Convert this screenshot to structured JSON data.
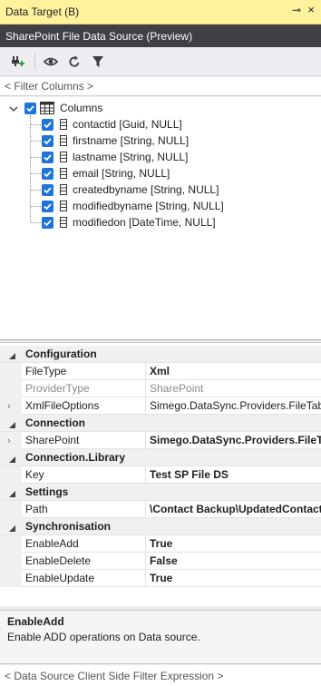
{
  "window": {
    "title": "Data Target (B)",
    "pin_glyph": "⊸",
    "close_glyph": "×"
  },
  "subheader": "SharePoint File Data Source (Preview)",
  "toolbar": {
    "icons": [
      "add-column-icon",
      "eye-icon",
      "refresh-icon",
      "filter-icon"
    ]
  },
  "filter_placeholder": "< Filter Columns >",
  "tree": {
    "root_label": "Columns",
    "columns": [
      "contactid [Guid, NULL]",
      "firstname [String, NULL]",
      "lastname [String, NULL]",
      "email [String, NULL]",
      "createdbyname [String, NULL]",
      "modifiedbyname [String, NULL]",
      "modifiedon [DateTime, NULL]"
    ]
  },
  "properties": {
    "categories": [
      {
        "name": "Configuration",
        "rows": [
          {
            "name": "FileType",
            "value": "Xml",
            "bold": true,
            "expandable": false,
            "readonly": false
          },
          {
            "name": "ProviderType",
            "value": "SharePoint",
            "bold": false,
            "expandable": false,
            "readonly": true
          },
          {
            "name": "XmlFileOptions",
            "value": "Simego.DataSync.Providers.FileTabl",
            "bold": false,
            "expandable": true,
            "readonly": false
          }
        ]
      },
      {
        "name": "Connection",
        "rows": [
          {
            "name": "SharePoint",
            "value": "Simego.DataSync.Providers.FileTa",
            "bold": true,
            "expandable": true,
            "readonly": false
          }
        ]
      },
      {
        "name": "Connection.Library",
        "rows": [
          {
            "name": "Key",
            "value": "Test SP File DS",
            "bold": true,
            "expandable": false,
            "readonly": false
          }
        ]
      },
      {
        "name": "Settings",
        "rows": [
          {
            "name": "Path",
            "value": "\\Contact Backup\\UpdatedContact",
            "bold": true,
            "expandable": false,
            "readonly": false
          }
        ]
      },
      {
        "name": "Synchronisation",
        "rows": [
          {
            "name": "EnableAdd",
            "value": "True",
            "bold": true,
            "expandable": false,
            "readonly": false
          },
          {
            "name": "EnableDelete",
            "value": "False",
            "bold": true,
            "expandable": false,
            "readonly": false
          },
          {
            "name": "EnableUpdate",
            "value": "True",
            "bold": true,
            "expandable": false,
            "readonly": false
          }
        ]
      }
    ]
  },
  "description": {
    "title": "EnableAdd",
    "text": "Enable ADD operations on Data source."
  },
  "footer_placeholder": "< Data Source Client Side Filter Expression >",
  "colors": {
    "accent_checkbox": "#1f74d8",
    "title_bar": "#fff29d",
    "subheader": "#3f3f46"
  }
}
